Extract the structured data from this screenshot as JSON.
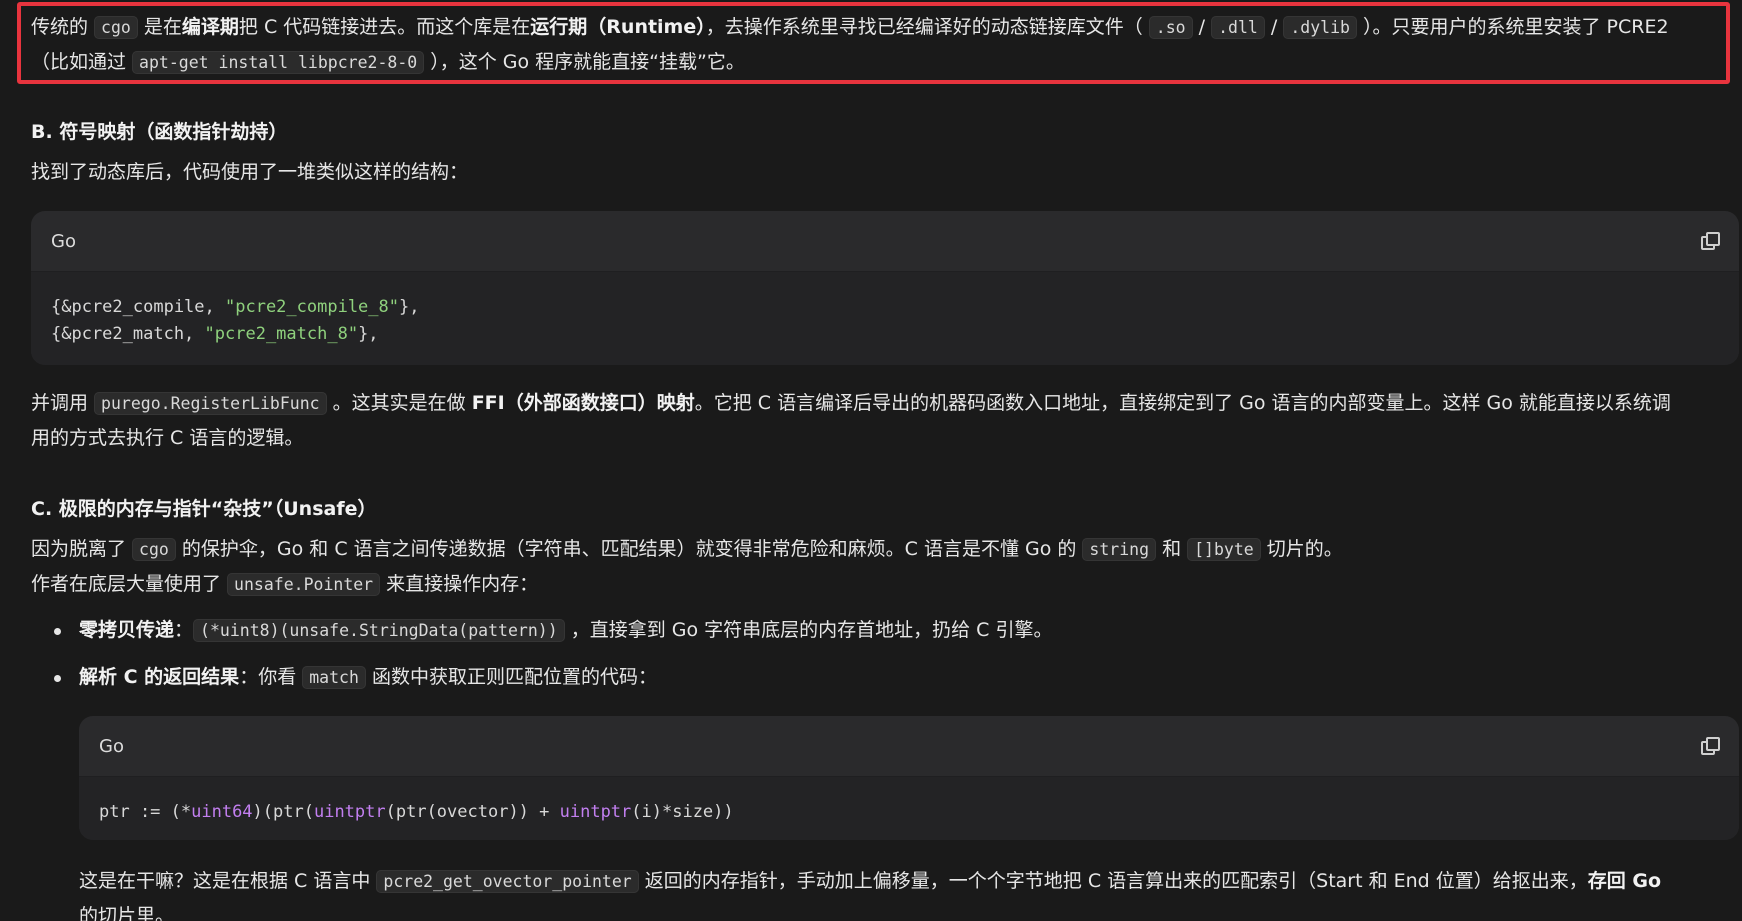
{
  "p1": {
    "t1": "传统的 ",
    "c1": "cgo",
    "t2": " 是在",
    "b1": "编译期",
    "t3": "把 C 代码链接进去。而这个库是在",
    "b2": "运行期（Runtime）",
    "t4": "，去操作系统里寻找已经编译好的动态链接库文件（ ",
    "c2": ".so",
    "t5": " / ",
    "c3": ".dll",
    "t6": " / ",
    "c4": ".dylib",
    "t7": " ）。只要用户的系统里安装了 PCRE2",
    "t8": "（比如通过 ",
    "c5": "apt-get install libpcre2-8-0",
    "t9": " ），这个 Go 程序就能直接“挂载”它。"
  },
  "sectionB": {
    "heading": "B. 符号映射（函数指针劫持）",
    "intro": "找到了动态库后，代码使用了一堆类似这样的结构："
  },
  "code1": {
    "lang": "Go",
    "l1a": "{&pcre2_compile, ",
    "l1s": "\"pcre2_compile_8\"",
    "l1b": "},",
    "l2a": "{&pcre2_match, ",
    "l2s": "\"pcre2_match_8\"",
    "l2b": "},"
  },
  "p2": {
    "t1": "并调用 ",
    "c1": "purego.RegisterLibFunc",
    "t2": " 。这其实是在做 ",
    "b1": "FFI（外部函数接口）映射",
    "t3": "。它把 C 语言编译后导出的机器码函数入口地址，直接绑定到了 Go 语言的内部变量上。这样 Go 就能直接以系统调",
    "t4": "用的方式去执行 C 语言的逻辑。"
  },
  "sectionC": {
    "heading": "C. 极限的内存与指针“杂技”（Unsafe）"
  },
  "p3": {
    "t1": "因为脱离了 ",
    "c1": "cgo",
    "t2": " 的保护伞，Go 和 C 语言之间传递数据（字符串、匹配结果）就变得非常危险和麻烦。C 语言是不懂 Go 的 ",
    "c2": "string",
    "t3": " 和 ",
    "c3": "[]byte",
    "t4": " 切片的。",
    "t5": "作者在底层大量使用了 ",
    "c4": "unsafe.Pointer",
    "t6": " 来直接操作内存："
  },
  "bullets": {
    "b1_label": "零拷贝传递",
    "b1_colon": "：",
    "b1_code": "(*uint8)(unsafe.StringData(pattern))",
    "b1_text": " ，直接拿到 Go 字符串底层的内存首地址，扔给 C 引擎。",
    "b2_label": "解析 C 的返回结果",
    "b2_text1": "：你看 ",
    "b2_code": "match",
    "b2_text2": " 函数中获取正则匹配位置的代码："
  },
  "code2": {
    "lang": "Go",
    "a": "ptr := (*",
    "k1": "uint64",
    "b": ")(ptr(",
    "k2": "uintptr",
    "c": "(ptr(ovector)) + ",
    "k3": "uintptr",
    "d": "(i)*size))"
  },
  "p4": {
    "t1": "这是在干嘛？这是在根据 C 语言中 ",
    "c1": "pcre2_get_ovector_pointer",
    "t2": " 返回的内存指针，手动加上偏移量，一个个字节地把 C 语言算出来的匹配索引（Start 和 End 位置）给抠出来，",
    "b1": "存回 Go",
    "t3": "的切片里。"
  }
}
